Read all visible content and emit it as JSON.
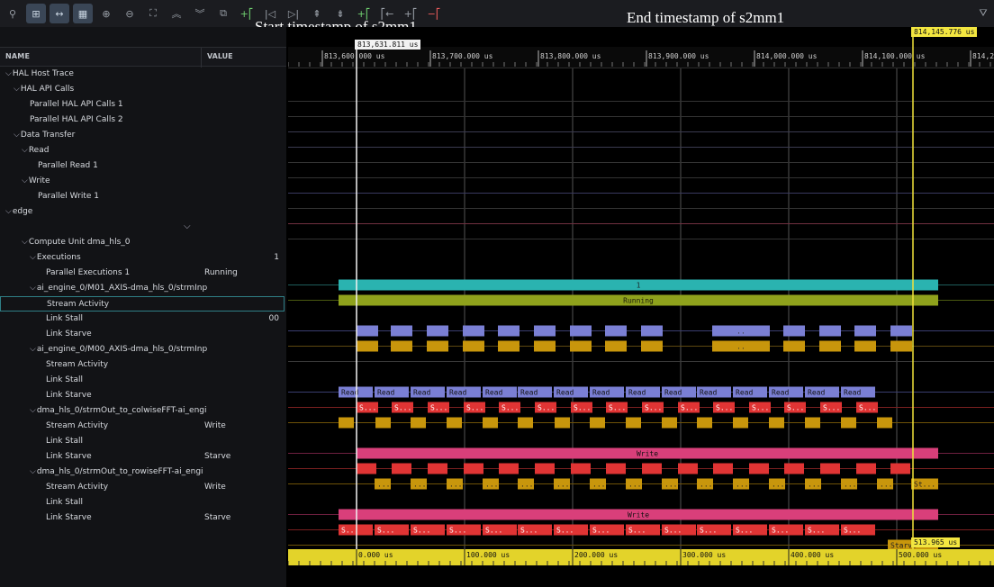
{
  "overlay": {
    "start_label": "Start timestamp of s2mm1",
    "end_label": "End timestamp of s2mm1"
  },
  "toolbar": {
    "icons": [
      "search-icon",
      "hierarchy-icon",
      "fit-width-icon",
      "grid-icon",
      "zoom-in-icon",
      "zoom-out-icon",
      "expand-icon",
      "chevron-up-icon",
      "chevron-down-icon",
      "view-icon",
      "add-marker-icon",
      "goto-start-icon",
      "goto-end-icon",
      "prev-event-icon",
      "next-event-icon",
      "add-range-icon",
      "range-start-icon",
      "range-end-icon",
      "remove-range-icon",
      "filter-icon"
    ]
  },
  "columns": {
    "name": "NAME",
    "value": "VALUE"
  },
  "tree": [
    {
      "label": "HAL Host Trace",
      "indent": 0,
      "expanded": true
    },
    {
      "label": "HAL API Calls",
      "indent": 1,
      "expanded": true
    },
    {
      "label": "Parallel HAL API Calls 1",
      "indent": 3
    },
    {
      "label": "Parallel HAL API Calls 2",
      "indent": 3
    },
    {
      "label": "Data Transfer",
      "indent": 1,
      "expanded": true
    },
    {
      "label": "Read",
      "indent": 2,
      "expanded": true
    },
    {
      "label": "Parallel Read 1",
      "indent": 4
    },
    {
      "label": "Write",
      "indent": 2,
      "expanded": true
    },
    {
      "label": "Parallel Write 1",
      "indent": 4
    },
    {
      "label": "edge",
      "indent": 0,
      "expanded": true
    },
    {
      "label": "",
      "indent": 0,
      "spacer": true
    },
    {
      "label": "Compute Unit dma_hls_0",
      "indent": 2,
      "expanded": true
    },
    {
      "label": "Executions",
      "indent": 3,
      "expanded": true,
      "num": "1"
    },
    {
      "label": "Parallel Executions 1",
      "indent": 5,
      "value": "Running"
    },
    {
      "label": "ai_engine_0/M01_AXIS-dma_hls_0/strmInp",
      "indent": 3,
      "expanded": true
    },
    {
      "label": "Stream Activity",
      "indent": 5,
      "selected": true
    },
    {
      "label": "Link Stall",
      "indent": 5,
      "num": "00"
    },
    {
      "label": "Link Starve",
      "indent": 5
    },
    {
      "label": "ai_engine_0/M00_AXIS-dma_hls_0/strmInp",
      "indent": 3,
      "expanded": true
    },
    {
      "label": "Stream Activity",
      "indent": 5
    },
    {
      "label": "Link Stall",
      "indent": 5
    },
    {
      "label": "Link Starve",
      "indent": 5
    },
    {
      "label": "dma_hls_0/strmOut_to_colwiseFFT-ai_engi",
      "indent": 3,
      "expanded": true
    },
    {
      "label": "Stream Activity",
      "indent": 5,
      "value": "Write"
    },
    {
      "label": "Link Stall",
      "indent": 5
    },
    {
      "label": "Link Starve",
      "indent": 5,
      "value": "Starve"
    },
    {
      "label": "dma_hls_0/strmOut_to_rowiseFFT-ai_engi",
      "indent": 3,
      "expanded": true
    },
    {
      "label": "Stream Activity",
      "indent": 5,
      "value": "Write"
    },
    {
      "label": "Link Stall",
      "indent": 5
    },
    {
      "label": "Link Starve",
      "indent": 5,
      "value": "Starve"
    }
  ],
  "timeline": {
    "top_ticks": [
      "813,600.000 us",
      "813,700.000 us",
      "813,800.000 us",
      "813,900.000 us",
      "814,000.000 us",
      "814,100.000 us",
      "814,2"
    ],
    "bottom_ticks": [
      "0.000 us",
      "100.000 us",
      "200.000 us",
      "300.000 us",
      "400.000 us",
      "500.000 us"
    ],
    "start_cursor": "813,631.811 us",
    "end_cursor": "814,145.776 us",
    "duration": "513.965 us",
    "labels": {
      "exec": "1",
      "running": "Running",
      "read": "Read",
      "stall": "S...",
      "starve_dots": "...",
      "write": "Write",
      "starve": "Starve",
      "st": "St...",
      "mid": ".."
    },
    "colors": {
      "teal": "#2ab3b0",
      "olive": "#8fa21c",
      "blue": "#7a7fd4",
      "amber": "#c8960c",
      "pink": "#d93f7a",
      "red": "#e03434",
      "cursor": "#f0e23a"
    }
  }
}
